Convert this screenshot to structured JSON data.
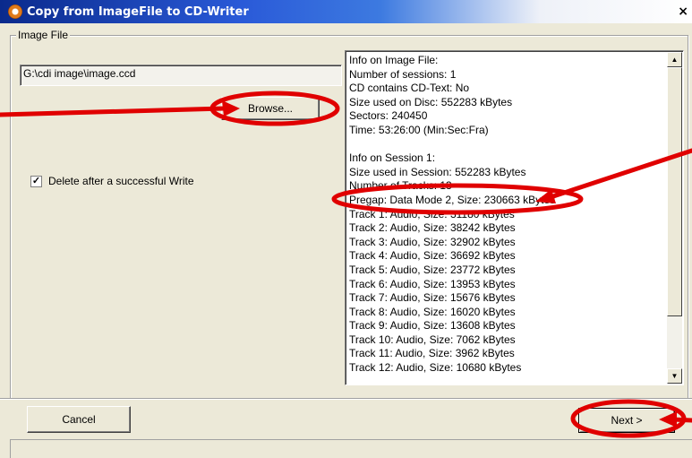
{
  "window": {
    "title": "Copy from ImageFile to CD-Writer",
    "close_glyph": "×"
  },
  "image_file_group": {
    "label": "Image File",
    "path_value": "G:\\cdi image\\image.ccd",
    "browse_label": "Browse...",
    "delete_checkbox": {
      "checked": true,
      "mark": "✓",
      "label": "Delete after a successful Write"
    }
  },
  "info_lines": [
    "Info on Image File:",
    "Number of sessions: 1",
    "CD contains CD-Text: No",
    "Size used on Disc: 552283 kBytes",
    "Sectors: 240450",
    "Time: 53:26:00 (Min:Sec:Fra)",
    "",
    "Info on Session 1:",
    "Size used in Session: 552283 kBytes",
    "Number of Tracks: 13",
    "Pregap: Data Mode 2, Size: 230663 kBytes",
    "Track 1: Audio, Size: 31180 kBytes",
    "Track 2: Audio, Size: 38242 kBytes",
    "Track 3: Audio, Size: 32902 kBytes",
    "Track 4: Audio, Size: 36692 kBytes",
    "Track 5: Audio, Size: 23772 kBytes",
    "Track 6: Audio, Size: 13953 kBytes",
    "Track 7: Audio, Size: 15676 kBytes",
    "Track 8: Audio, Size: 16020 kBytes",
    "Track 9: Audio, Size: 13608 kBytes",
    "Track 10: Audio, Size: 7062 kBytes",
    "Track 11: Audio, Size: 3962 kBytes",
    "Track 12: Audio, Size: 10680 kBytes"
  ],
  "footer": {
    "cancel_label": "Cancel",
    "next_label": "Next >"
  },
  "icons": {
    "scroll_up": "▲",
    "scroll_down": "▼"
  },
  "colors": {
    "annotation": "#e00000",
    "title_start": "#0a2a8c",
    "title_end": "#ffffff",
    "window_bg": "#ece9d8"
  }
}
